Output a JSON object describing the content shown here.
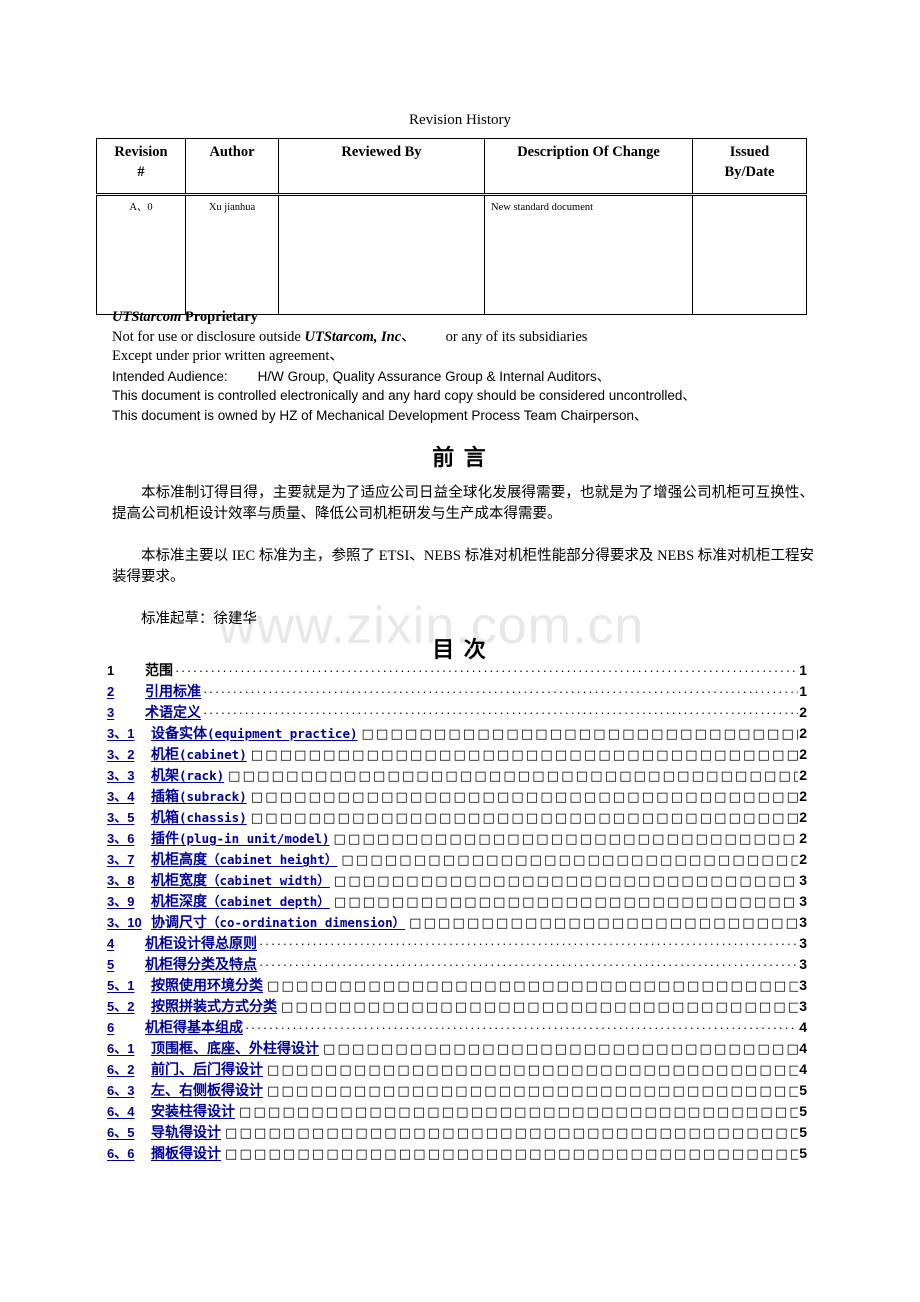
{
  "watermark": "www.zixin.com.cn",
  "revision_history": {
    "title": "Revision History",
    "columns": [
      "Revision #",
      "Author",
      "Reviewed By",
      "Description Of Change",
      "Issued By/Date"
    ],
    "column_lines": [
      [
        "Revision",
        "#"
      ],
      [
        "Author"
      ],
      [
        "Reviewed By"
      ],
      [
        "Description Of Change"
      ],
      [
        "Issued",
        "By/Date"
      ]
    ],
    "rows": [
      {
        "revision": "A、0",
        "author": "Xu jianhua",
        "reviewed_by": "",
        "description": "New standard document",
        "issued_by_date": ""
      }
    ]
  },
  "notice": {
    "line1_a": "UTStarcom",
    "line1_b": " Proprietary",
    "line2_a": "Not for use or disclosure outside ",
    "line2_b": "UTStarcom, Inc",
    "line2_c": "、",
    "line2_d": "or any of its subsidiaries",
    "line3": "Except under prior written agreement、",
    "line4_a": "Intended Audience:",
    "line4_b": "H/W Group, Quality Assurance Group & Internal Auditors、",
    "line5": "This document is controlled electronically and any hard copy should be considered uncontrolled、",
    "line6": "This document is owned by HZ of Mechanical Development Process Team Chairperson、"
  },
  "preface": {
    "title": "前    言",
    "paragraph1": "本标准制订得目得，主要就是为了适应公司日益全球化发展得需要，也就是为了增强公司机柜可互换性、提高公司机柜设计效率与质量、降低公司机柜研发与生产成本得需要。",
    "paragraph2": "本标准主要以 IEC 标准为主，参照了 ETSI、NEBS 标准对机柜性能部分得要求及 NEBS 标准对机柜工程安装得要求。",
    "drafter": "标准起草：徐建华"
  },
  "toc": {
    "title": "目    次",
    "entries": [
      {
        "num": "1",
        "label": "范围",
        "label_en": "",
        "page": "1",
        "level": 1,
        "leader": "dots",
        "link": false
      },
      {
        "num": "2",
        "label": "引用标准",
        "label_en": "",
        "page": "1",
        "level": 1,
        "leader": "dots",
        "link": true
      },
      {
        "num": "3",
        "label": "术语定义",
        "label_en": "",
        "page": "2",
        "level": 1,
        "leader": "dots",
        "link": true
      },
      {
        "num": "3、1",
        "label": "设备实体",
        "label_en": "(equipment practice)",
        "page": "2",
        "level": 2,
        "leader": "boxes",
        "link": true
      },
      {
        "num": "3、2",
        "label": "机柜",
        "label_en": "(cabinet)",
        "page": "2",
        "level": 2,
        "leader": "boxes",
        "link": true
      },
      {
        "num": "3、3",
        "label": "机架",
        "label_en": "(rack)",
        "page": "2",
        "level": 2,
        "leader": "boxes",
        "link": true
      },
      {
        "num": "3、4",
        "label": "插箱",
        "label_en": "(subrack)",
        "page": "2",
        "level": 2,
        "leader": "boxes",
        "link": true
      },
      {
        "num": "3、5",
        "label": "机箱",
        "label_en": "(chassis)",
        "page": "2",
        "level": 2,
        "leader": "boxes",
        "link": true
      },
      {
        "num": "3、6",
        "label": "插件",
        "label_en": "(plug-in unit/model)",
        "page": "2",
        "level": 2,
        "leader": "boxes",
        "link": true
      },
      {
        "num": "3、7",
        "label": "机柜高度",
        "label_en": "（cabinet height）",
        "page": "2",
        "level": 2,
        "leader": "boxes",
        "link": true
      },
      {
        "num": "3、8",
        "label": "机柜宽度",
        "label_en": "（cabinet width）",
        "page": "3",
        "level": 2,
        "leader": "boxes",
        "link": true
      },
      {
        "num": "3、9",
        "label": "机柜深度",
        "label_en": "（cabinet depth）",
        "page": "3",
        "level": 2,
        "leader": "boxes",
        "link": true
      },
      {
        "num": "3、10",
        "label": "协调尺寸",
        "label_en": "（co-ordination dimension）",
        "page": "3",
        "level": 2,
        "leader": "boxes",
        "link": true
      },
      {
        "num": "4",
        "label": "机柜设计得总原则",
        "label_en": "",
        "page": "3",
        "level": 1,
        "leader": "dots",
        "link": true
      },
      {
        "num": "5",
        "label": "机柜得分类及特点",
        "label_en": "",
        "page": "3",
        "level": 1,
        "leader": "dots",
        "link": true
      },
      {
        "num": "5、1",
        "label": "按照使用环境分类",
        "label_en": "",
        "page": "3",
        "level": 2,
        "leader": "boxes",
        "link": true
      },
      {
        "num": "5、2",
        "label": "按照拼装式方式分类",
        "label_en": "",
        "page": "3",
        "level": 2,
        "leader": "boxes",
        "link": true
      },
      {
        "num": "6",
        "label": "机柜得基本组成",
        "label_en": "",
        "page": "4",
        "level": 1,
        "leader": "dots",
        "link": true
      },
      {
        "num": "6、1",
        "label": "顶围框、底座、外柱得设计",
        "label_en": "",
        "page": "4",
        "level": 2,
        "leader": "boxes",
        "link": true
      },
      {
        "num": "6、2",
        "label": "前门、后门得设计",
        "label_en": "",
        "page": "4",
        "level": 2,
        "leader": "boxes",
        "link": true
      },
      {
        "num": "6、3",
        "label": "左、右侧板得设计",
        "label_en": "",
        "page": "5",
        "level": 2,
        "leader": "boxes",
        "link": true
      },
      {
        "num": "6、4",
        "label": "安装柱得设计",
        "label_en": "",
        "page": "5",
        "level": 2,
        "leader": "boxes",
        "link": true
      },
      {
        "num": "6、5",
        "label": "导轨得设计",
        "label_en": "",
        "page": "5",
        "level": 2,
        "leader": "boxes",
        "link": true
      },
      {
        "num": "6、6",
        "label": "搁板得设计",
        "label_en": "",
        "page": "5",
        "level": 2,
        "leader": "boxes",
        "link": true
      }
    ]
  },
  "colors": {
    "link": "#00009A",
    "text": "#000000",
    "watermark": "#e8e8e8"
  }
}
